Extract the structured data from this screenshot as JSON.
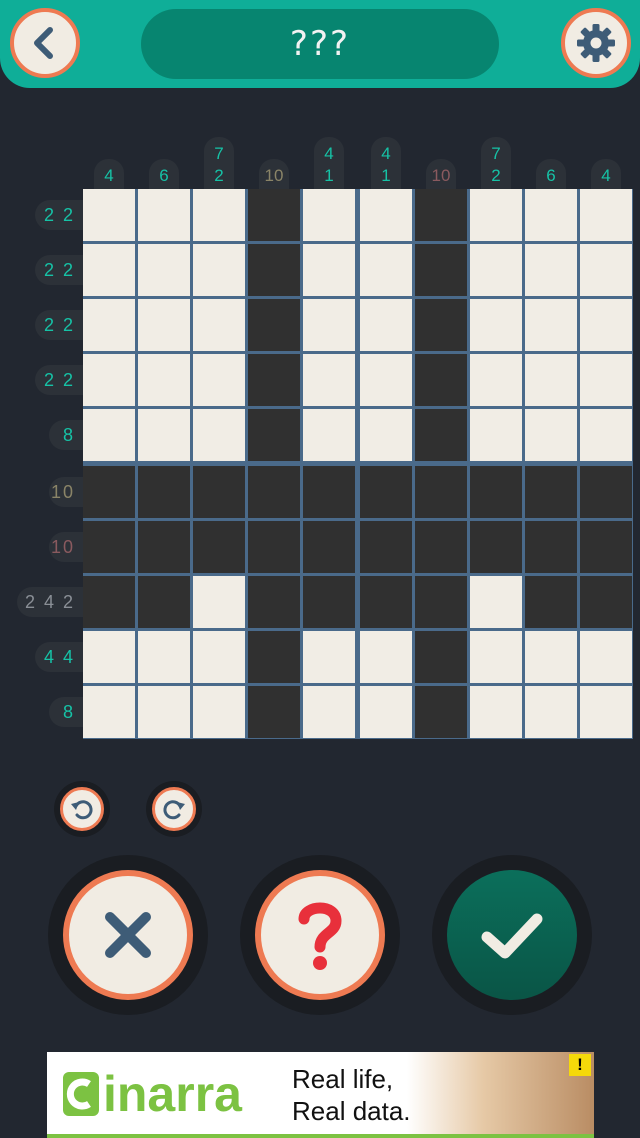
{
  "header": {
    "title": "???",
    "back_icon": "chevron-left-icon",
    "settings_icon": "gear-icon"
  },
  "puzzle": {
    "size": 10,
    "column_clues": [
      [
        "4"
      ],
      [
        "6"
      ],
      [
        "7",
        "2"
      ],
      [
        "10"
      ],
      [
        "4",
        "1"
      ],
      [
        "4",
        "1"
      ],
      [
        "10"
      ],
      [
        "7",
        "2"
      ],
      [
        "6"
      ],
      [
        "4"
      ]
    ],
    "column_clue_colors": [
      "#16c2a6",
      "#16c2a6",
      "#16c2a6",
      "#8a8467",
      "#16c2a6",
      "#16c2a6",
      "#8a5a5f",
      "#16c2a6",
      "#16c2a6",
      "#16c2a6"
    ],
    "row_clues": [
      "2 2",
      "2 2",
      "2 2",
      "2 2",
      "8",
      "10",
      "10",
      "2 4 2",
      "4 4",
      "8"
    ],
    "row_clue_colors": [
      "#16c2a6",
      "#16c2a6",
      "#16c2a6",
      "#16c2a6",
      "#16c2a6",
      "#8a8467",
      "#8a5a5f",
      "#8a8f96",
      "#16c2a6",
      "#16c2a6"
    ],
    "cells": [
      "WWWBWWBWWW",
      "WWWBWWBWWW",
      "WWWBWWBWWW",
      "WWWBWWBWWW",
      "WWWBWWBWWW",
      "BBBBBBBBBB",
      "BBBBBBBBBB",
      "BBWBBBBWBB",
      "WWWBWWBWWW",
      "WWWBWWBWWW"
    ]
  },
  "controls": {
    "undo_icon": "undo-icon",
    "redo_icon": "redo-icon",
    "clear_icon": "close-icon",
    "hint_icon": "question-icon",
    "check_icon": "check-icon"
  },
  "ad": {
    "brand": "inarra",
    "line1": "Real life,",
    "line2": "Real data.",
    "badge": "!"
  }
}
